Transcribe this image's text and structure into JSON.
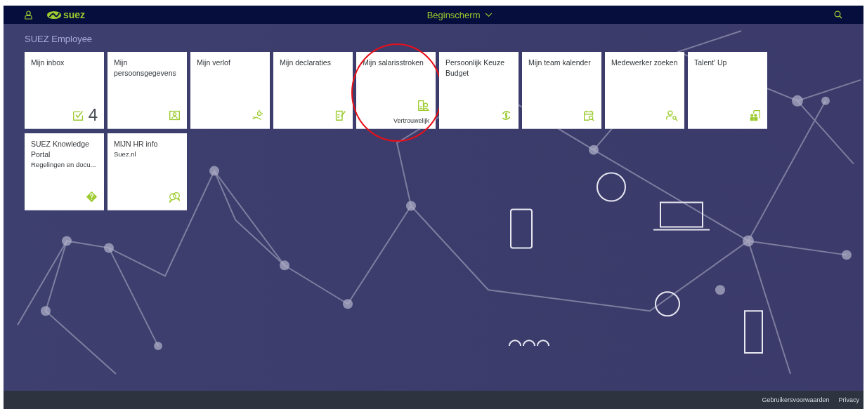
{
  "header": {
    "logo_text": "suez",
    "title": "Beginscherm"
  },
  "section": {
    "title": "SUEZ Employee"
  },
  "tiles": [
    {
      "title": "Mijn inbox",
      "count": "4",
      "annotated": false
    },
    {
      "title": "Mijn persoonsgegevens",
      "annotated": false
    },
    {
      "title": "Mijn verlof",
      "annotated": false
    },
    {
      "title": "Mijn declaraties",
      "annotated": false
    },
    {
      "title": "Mijn salarisstroken",
      "footer": "Vertrouwelijk",
      "annotated": true
    },
    {
      "title": "Persoonlijk Keuze Budget",
      "annotated": false
    },
    {
      "title": "Mijn team kalender",
      "annotated": false
    },
    {
      "title": "Medewerker zoeken",
      "annotated": false
    },
    {
      "title": "Talent' Up",
      "annotated": false
    },
    {
      "title": "SUEZ Knowledge Portal",
      "subtitle": "Regelingen en docu...",
      "annotated": false
    },
    {
      "title": "MIJN HR info",
      "subtitle": "Suez.nl",
      "annotated": false
    }
  ],
  "footer": {
    "links": [
      "Gebruikersvoorwaarden",
      "Privacy"
    ]
  }
}
